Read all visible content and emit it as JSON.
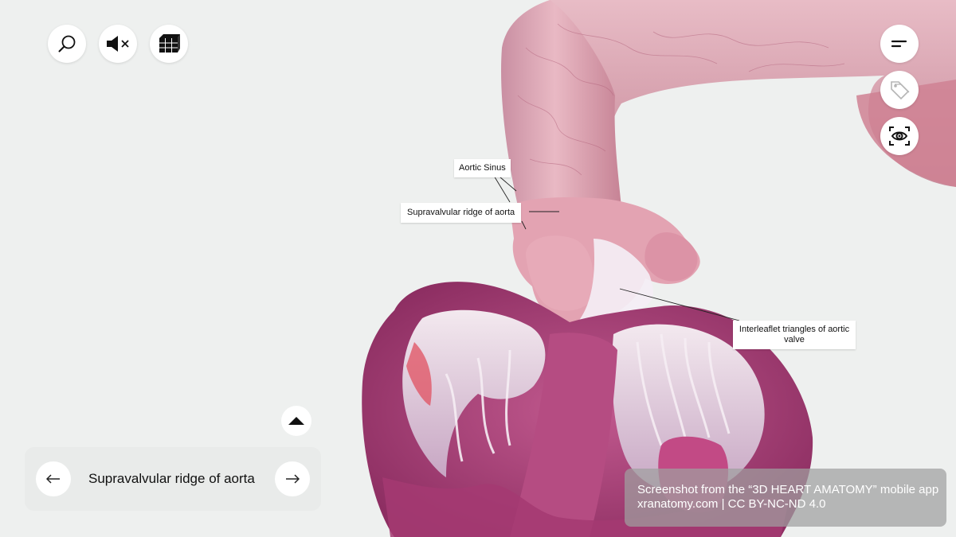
{
  "toolbar": {
    "left_buttons": [
      {
        "name": "search-icon"
      },
      {
        "name": "sound-muted-icon"
      },
      {
        "name": "layers-icon"
      }
    ],
    "right_buttons": [
      {
        "name": "menu-icon"
      },
      {
        "name": "tag-icon"
      },
      {
        "name": "view-eye-icon"
      }
    ]
  },
  "labels": {
    "aortic_sinus": "Aortic Sinus",
    "supravalvular_ridge": "Supravalvular ridge of aorta",
    "interleaflet_triangles": "Interleaflet triangles of aortic valve"
  },
  "navigator": {
    "title": "Supravalvular ridge of aorta",
    "prev_icon": "arrow-left-icon",
    "next_icon": "arrow-right-icon",
    "expand_icon": "chevron-up-icon"
  },
  "credit": {
    "line1": "Screenshot from the “3D HEART AMATOMY” mobile app",
    "line2": "xranatomy.com | CC BY-NC-ND 4.0"
  },
  "colors": {
    "background": "#eef0ef",
    "tissue_dark": "#a6467a",
    "tissue_light": "#e6a9b8",
    "valve_white": "#f2eef4"
  }
}
